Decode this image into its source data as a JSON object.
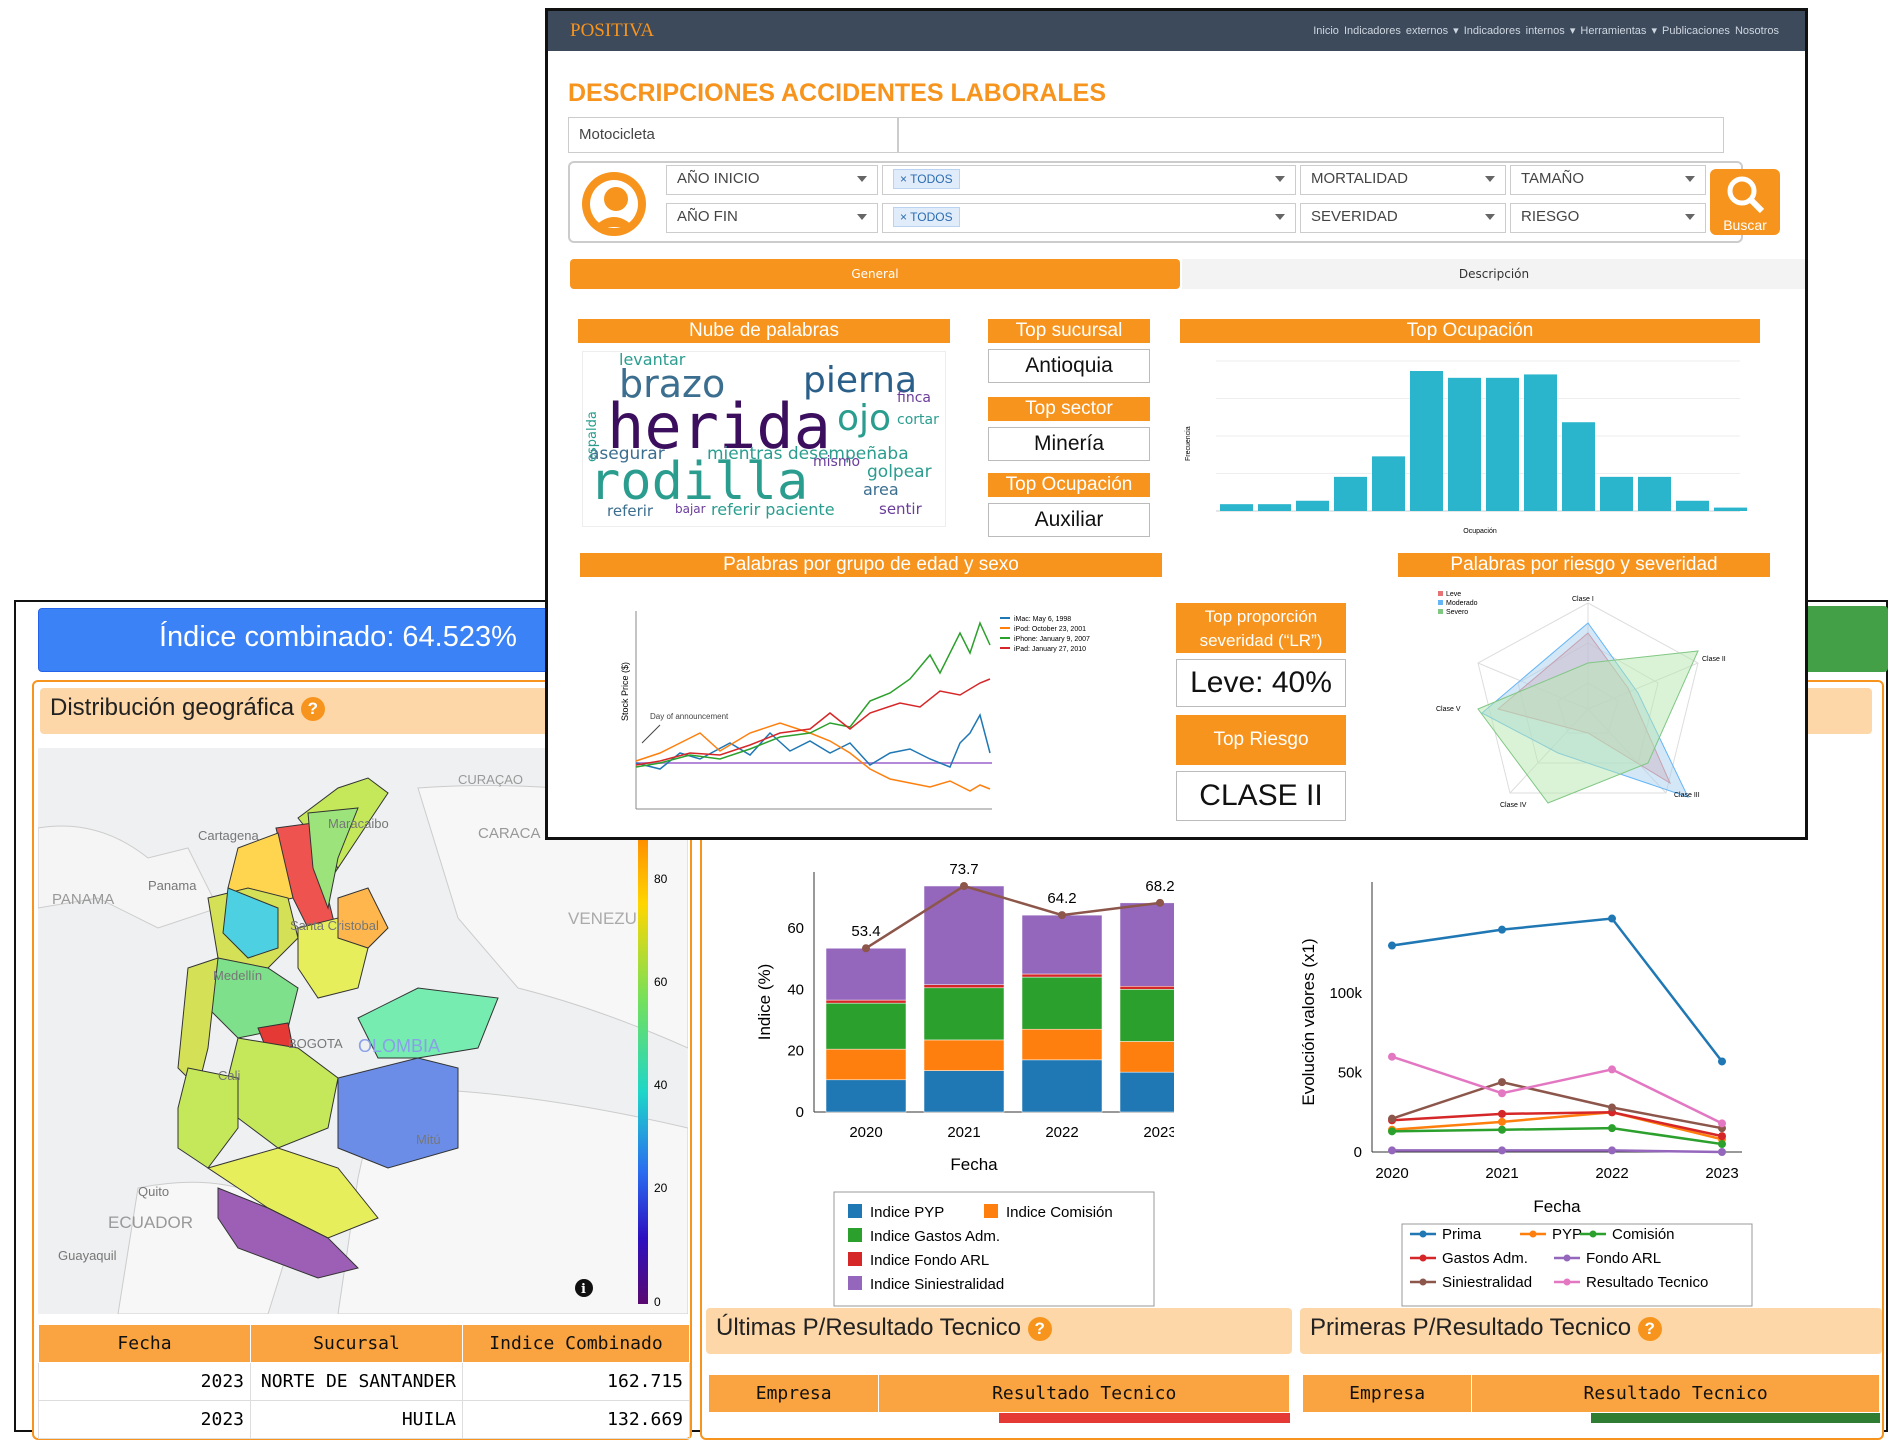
{
  "back": {
    "combined_index": "Índice combinado: 64.523%",
    "geo_title": "Distribución geográfica",
    "map_labels": [
      "CURAÇAO",
      "Cartagena",
      "Maracaibo",
      "CARACA",
      "PANAMA",
      "Panama",
      "VENEZU",
      "Medellín",
      "Santa Cristobal",
      "BOGOTA",
      "OLOMBIA",
      "Cali",
      "Mitú",
      "Quito",
      "ECUADOR",
      "Guayaquil"
    ],
    "colorbar_ticks": [
      "80",
      "60",
      "40",
      "20",
      "0"
    ],
    "table_headers": [
      "Fecha",
      "Sucursal",
      "Indice Combinado"
    ],
    "table_rows": [
      [
        "2023",
        "NORTE DE SANTANDER",
        "162.715"
      ],
      [
        "2023",
        "HUILA",
        "132.669"
      ]
    ],
    "ultimas_title": "Últimas P/Resultado Tecnico",
    "primeras_title": "Primeras P/Resultado Tecnico",
    "ultimas_headers": [
      "Empresa",
      "Resultado Tecnico"
    ],
    "primeras_headers": [
      "Empresa",
      "Resultado Tecnico"
    ]
  },
  "chart_data": [
    {
      "type": "bar",
      "stacked": true,
      "categories": [
        "2020",
        "2021",
        "2022",
        "2023"
      ],
      "xlabel": "Fecha",
      "ylabel": "Indice (%)",
      "ylim": [
        0,
        75
      ],
      "yticks": [
        "0",
        "20",
        "40",
        "60"
      ],
      "series": [
        {
          "name": "Indice PYP",
          "color": "#1f77b4",
          "values": [
            10.5,
            13.5,
            17,
            13
          ]
        },
        {
          "name": "Indice Comisión",
          "color": "#ff7f0e",
          "values": [
            10,
            10,
            10,
            10
          ]
        },
        {
          "name": "Indice Gastos Adm.",
          "color": "#2ca02c",
          "values": [
            15,
            17,
            17,
            17
          ]
        },
        {
          "name": "Indice Fondo ARL",
          "color": "#d62728",
          "values": [
            1,
            1,
            1,
            1
          ]
        },
        {
          "name": "Indice Siniestralidad",
          "color": "#9467bd",
          "values": [
            16.9,
            32.2,
            19.2,
            27.2
          ]
        }
      ],
      "line": {
        "color": "#8c564b",
        "values": [
          53.4,
          73.7,
          64.2,
          68.2
        ],
        "labels": [
          "53.4",
          "73.7",
          "64.2",
          "68.2"
        ]
      }
    },
    {
      "type": "line",
      "x": [
        "2020",
        "2021",
        "2022",
        "2023"
      ],
      "xlabel": "Fecha",
      "ylabel": "Evolución valores (x1)",
      "ylim": [
        0,
        150000
      ],
      "yticks": [
        "0",
        "50k",
        "100k"
      ],
      "series": [
        {
          "name": "Prima",
          "color": "#1f77b4",
          "values": [
            130000,
            140000,
            147000,
            57000
          ]
        },
        {
          "name": "PYP",
          "color": "#ff7f0e",
          "values": [
            14000,
            19000,
            25000,
            8000
          ]
        },
        {
          "name": "Comisión",
          "color": "#2ca02c",
          "values": [
            13000,
            14000,
            15000,
            5000
          ]
        },
        {
          "name": "Gastos Adm.",
          "color": "#d62728",
          "values": [
            20000,
            24000,
            25000,
            10000
          ]
        },
        {
          "name": "Fondo ARL",
          "color": "#9467bd",
          "values": [
            1000,
            1000,
            1000,
            0
          ]
        },
        {
          "name": "Siniestralidad",
          "color": "#8c564b",
          "values": [
            21000,
            44000,
            28000,
            15000
          ]
        },
        {
          "name": "Resultado Tecnico",
          "color": "#e377c2",
          "values": [
            60000,
            37000,
            52000,
            18000
          ]
        }
      ]
    },
    {
      "type": "bar",
      "title": "Top Ocupación",
      "xlabel": "Ocupación",
      "ylabel": "Frecuencia",
      "values": [
        2,
        2,
        3,
        10,
        16,
        41,
        39,
        39,
        40,
        26,
        10,
        10,
        3,
        1
      ]
    }
  ],
  "front": {
    "nav_logo": "POSITIVA",
    "nav_menu": "Inicio  Indicadores externos ▾  Indicadores internos ▾  Herramientas ▾  Publicaciones  Nosotros",
    "page_title": "DESCRIPCIONES ACCIDENTES LABORALES",
    "search_value": "Motocicleta",
    "filters": {
      "ano_inicio": "AÑO INICIO",
      "ano_fin": "AÑO FIN",
      "todos_1": "TODOS",
      "todos_2": "TODOS",
      "mortalidad": "MORTALIDAD",
      "severidad": "SEVERIDAD",
      "tamano": "TAMAÑO",
      "riesgo": "RIESGO",
      "buscar": "Buscar"
    },
    "tabs": [
      "General",
      "Descripción"
    ],
    "wordcloud_title": "Nube de palabras",
    "wordcloud_words": [
      "herida",
      "rodilla",
      "brazo",
      "pierna",
      "ojo",
      "levantar",
      "asegurar",
      "mientras desempeñaba",
      "referir paciente",
      "golpear",
      "area",
      "sentir",
      "finca",
      "cortar",
      "espalda",
      "mismo",
      "referir",
      "bajar"
    ],
    "top_sucursal_title": "Top sucursal",
    "top_sucursal": "Antioquia",
    "top_sector_title": "Top sector",
    "top_sector": "Minería",
    "top_ocupacion_title": "Top Ocupación",
    "top_ocupacion": "Auxiliar",
    "top_ocupacion_chart_title": "Top Ocupación",
    "edad_sexo_title": "Palabras por grupo de edad y sexo",
    "edad_legend": [
      "iMac: May 6, 1998",
      "iPod: October 23, 2001",
      "iPhone: January 9, 2007",
      "iPad: January 27, 2010"
    ],
    "edad_annotation": "Day of announcement",
    "edad_ylabel": "Stock Price ($)",
    "top_proporcion_title": "Top proporción severidad (“LR”)",
    "top_proporcion": "Leve: 40%",
    "top_riesgo_title": "Top Riesgo",
    "top_riesgo": "CLASE II",
    "riesgo_sev_title": "Palabras por riesgo y severidad",
    "radar_legend": [
      "Leve",
      "Moderado",
      "Severo"
    ],
    "radar_axes": [
      "Clase I",
      "Clase II",
      "Clase III",
      "Clase IV",
      "Clase V"
    ]
  }
}
